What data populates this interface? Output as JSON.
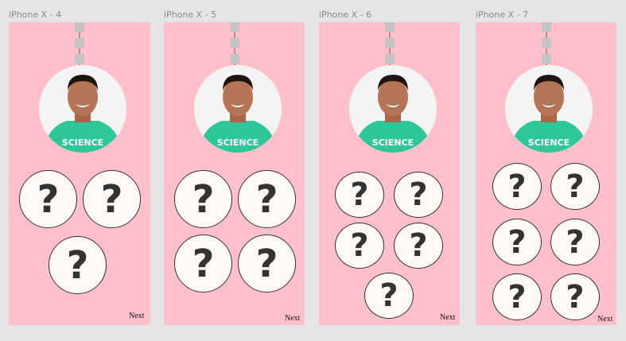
{
  "frames": [
    {
      "label": "iPhone X - 4",
      "next_label": "Next",
      "question_mark": "?"
    },
    {
      "label": "iPhone X - 5",
      "next_label": "Next",
      "question_mark": "?"
    },
    {
      "label": "iPhone X - 6",
      "next_label": "Next",
      "question_mark": "?"
    },
    {
      "label": "iPhone X - 7",
      "next_label": "Next",
      "question_mark": "?"
    }
  ],
  "avatar": {
    "shirt_text": "SCIENCE"
  },
  "colors": {
    "canvas": "#e5e5e5",
    "frame_bg": "#ffc0cb",
    "circle_fill": "#fffaf6",
    "shirt": "#2ec79a"
  }
}
